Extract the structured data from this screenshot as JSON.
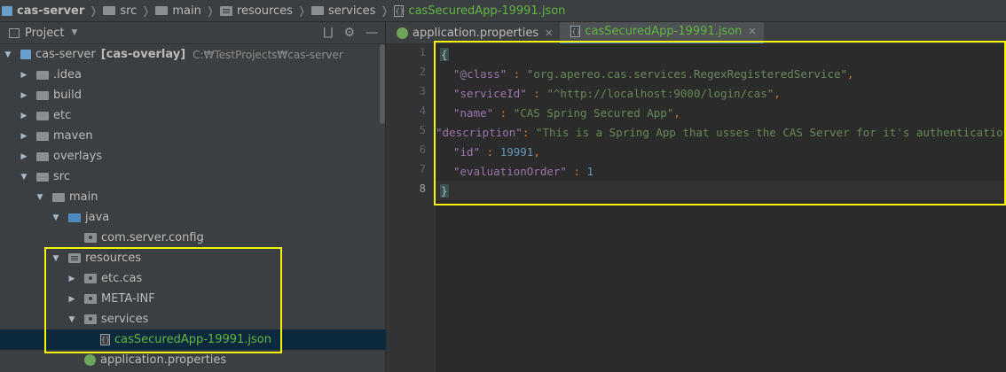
{
  "breadcrumb": {
    "items": [
      "cas-server",
      "src",
      "main",
      "resources",
      "services",
      "casSecuredApp-19991.json"
    ]
  },
  "project_panel": {
    "title": "Project"
  },
  "tree": {
    "root_label": "cas-server",
    "root_module": "[cas-overlay]",
    "root_path": "C:₩TestProjects₩cas-server",
    "idea": ".idea",
    "build": "build",
    "etc": "etc",
    "maven": "maven",
    "overlays": "overlays",
    "src": "src",
    "main": "main",
    "java": "java",
    "config": "com.server.config",
    "resources": "resources",
    "etc_cas": "etc.cas",
    "meta_inf": "META-INF",
    "services": "services",
    "json_file": "casSecuredApp-19991.json",
    "app_props": "application.properties"
  },
  "tabs": {
    "tab1": "application.properties",
    "tab2": "casSecuredApp-19991.json"
  },
  "editor": {
    "line_numbers": [
      "1",
      "2",
      "3",
      "4",
      "5",
      "6",
      "7",
      "8"
    ],
    "open_brace": "{",
    "close_brace": "}",
    "k_class": "\"@class\"",
    "v_class": "\"org.apereo.cas.services.RegexRegisteredService\"",
    "k_serviceId": "\"serviceId\"",
    "v_serviceId": "\"^http://localhost:9000/login/cas\"",
    "k_name": "\"name\"",
    "v_name": "\"CAS Spring Secured App\"",
    "k_description": "\"description\"",
    "v_description": "\"This is a Spring App that usses the CAS Server for it's authentication\"",
    "k_id": "\"id\"",
    "v_id": "19991",
    "k_eval": "\"evaluationOrder\"",
    "v_eval": "1",
    "colon": " : ",
    "colon_tight": ": ",
    "comma": ","
  },
  "colors": {
    "highlight": "#fcf30a",
    "key": "#9876aa",
    "string": "#6a8759",
    "number": "#6897bb",
    "green_file": "#62b543"
  }
}
